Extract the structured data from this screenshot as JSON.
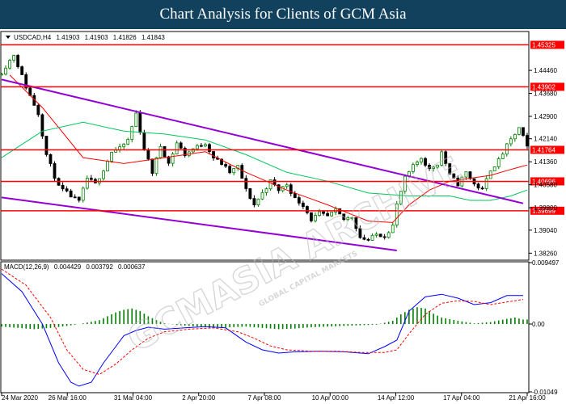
{
  "banner_title": "Chart Analysis for Clients of GCM Asia",
  "watermark": {
    "brand": "GCMASIA ARCHIVE",
    "tagline": "GLOBAL CAPITAL MARKETS"
  },
  "colors": {
    "banner": "#12415e",
    "bull_candle": "#008000",
    "bear_candle": "#000000",
    "support_resistance": "#ff0000",
    "trend_channel": "#9400d3",
    "ma_fast": "#ff0000",
    "ma_slow": "#00c85a",
    "macd_line": "#0000ff",
    "signal_line": "#ff0000",
    "histogram": "#008000"
  },
  "chart_data": [
    {
      "type": "candlestick",
      "header": {
        "symbol": "USDCAD,H4",
        "open": "1.41903",
        "high": "1.41903",
        "low": "1.41826",
        "close": "1.41843"
      },
      "ylim": [
        1.3805,
        1.4575
      ],
      "y_ticks": [
        "1.44460",
        "1.43680",
        "1.42900",
        "1.42140",
        "1.41360",
        "1.40580",
        "1.39800",
        "1.39040",
        "1.38260"
      ],
      "x_ticks": [
        "24 Mar 2020",
        "26 Mar 16:00",
        "31 Mar 04:00",
        "2 Apr 20:00",
        "7 Apr 08:00",
        "10 Apr 00:00",
        "14 Apr 12:00",
        "17 Apr 04:00",
        "21 Apr 16:00"
      ],
      "levels": [
        {
          "value": 1.45325,
          "label": "1.45325"
        },
        {
          "value": 1.43902,
          "label": "1.43902"
        },
        {
          "value": 1.41764,
          "label": "1.41764"
        },
        {
          "value": 1.40696,
          "label": "1.40696"
        },
        {
          "value": 1.39699,
          "label": "1.39699"
        }
      ],
      "trend_channel": [
        {
          "name": "upper",
          "from": [
            0,
            1.4415
          ],
          "to": [
            128,
            1.3995
          ]
        },
        {
          "name": "lower",
          "from": [
            0,
            1.4015
          ],
          "to": [
            97,
            1.3835
          ]
        }
      ],
      "close_path": [
        [
          0,
          1.444
        ],
        [
          3,
          1.45
        ],
        [
          6,
          1.439
        ],
        [
          9,
          1.43
        ],
        [
          11,
          1.416
        ],
        [
          14,
          1.405
        ],
        [
          17,
          1.402
        ],
        [
          19,
          1.4
        ],
        [
          21,
          1.408
        ],
        [
          23,
          1.406
        ],
        [
          25,
          1.411
        ],
        [
          27,
          1.417
        ],
        [
          29,
          1.418
        ],
        [
          31,
          1.421
        ],
        [
          33,
          1.43
        ],
        [
          35,
          1.418
        ],
        [
          37,
          1.41
        ],
        [
          39,
          1.419
        ],
        [
          41,
          1.413
        ],
        [
          43,
          1.42
        ],
        [
          45,
          1.416
        ],
        [
          47,
          1.418
        ],
        [
          50,
          1.42
        ],
        [
          52,
          1.415
        ],
        [
          54,
          1.413
        ],
        [
          56,
          1.41
        ],
        [
          58,
          1.412
        ],
        [
          60,
          1.404
        ],
        [
          62,
          1.399
        ],
        [
          64,
          1.403
        ],
        [
          66,
          1.407
        ],
        [
          68,
          1.404
        ],
        [
          70,
          1.406
        ],
        [
          72,
          1.401
        ],
        [
          74,
          1.399
        ],
        [
          76,
          1.394
        ],
        [
          78,
          1.396
        ],
        [
          80,
          1.395
        ],
        [
          82,
          1.397
        ],
        [
          84,
          1.394
        ],
        [
          86,
          1.395
        ],
        [
          88,
          1.388
        ],
        [
          90,
          1.387
        ],
        [
          92,
          1.389
        ],
        [
          94,
          1.3885
        ],
        [
          96,
          1.392
        ],
        [
          97,
          1.399
        ],
        [
          99,
          1.408
        ],
        [
          101,
          1.412
        ],
        [
          103,
          1.415
        ],
        [
          105,
          1.411
        ],
        [
          107,
          1.413
        ],
        [
          108,
          1.417
        ],
        [
          110,
          1.409
        ],
        [
          112,
          1.406
        ],
        [
          114,
          1.41
        ],
        [
          116,
          1.406
        ],
        [
          118,
          1.404
        ],
        [
          120,
          1.411
        ],
        [
          122,
          1.414
        ],
        [
          124,
          1.419
        ],
        [
          126,
          1.423
        ],
        [
          127,
          1.425
        ],
        [
          128,
          1.422
        ],
        [
          129,
          1.4184
        ]
      ],
      "moving_averages": [
        {
          "name": "fast",
          "values": [
            [
              2,
              1.443
            ],
            [
              10,
              1.432
            ],
            [
              20,
              1.415
            ],
            [
              30,
              1.413
            ],
            [
              40,
              1.415
            ],
            [
              50,
              1.417
            ],
            [
              60,
              1.41
            ],
            [
              70,
              1.404
            ],
            [
              80,
              1.399
            ],
            [
              90,
              1.3935
            ],
            [
              96,
              1.393
            ],
            [
              100,
              1.399
            ],
            [
              105,
              1.404
            ],
            [
              110,
              1.407
            ],
            [
              115,
              1.408
            ],
            [
              120,
              1.409
            ],
            [
              125,
              1.411
            ],
            [
              129,
              1.4125
            ]
          ]
        },
        {
          "name": "slow",
          "values": [
            [
              0,
              1.415
            ],
            [
              10,
              1.424
            ],
            [
              20,
              1.427
            ],
            [
              30,
              1.424
            ],
            [
              40,
              1.423
            ],
            [
              50,
              1.421
            ],
            [
              60,
              1.416
            ],
            [
              70,
              1.41
            ],
            [
              80,
              1.407
            ],
            [
              90,
              1.403
            ],
            [
              100,
              1.402
            ],
            [
              110,
              1.402
            ],
            [
              115,
              1.4005
            ],
            [
              120,
              1.4005
            ],
            [
              125,
              1.402
            ],
            [
              129,
              1.404
            ]
          ]
        }
      ]
    },
    {
      "type": "histogram",
      "header": {
        "name": "MACD(12,26,9)",
        "main": "0.004429",
        "signal": "0.003792",
        "histogram": "0.000637"
      },
      "ylim": [
        -0.01049,
        0.009497
      ],
      "y_ticks": [
        "0.009497",
        "0.00",
        "-0.01049"
      ],
      "histogram": [
        [
          0,
          -0.0004
        ],
        [
          4,
          -0.0006
        ],
        [
          8,
          -0.0008
        ],
        [
          12,
          -0.0006
        ],
        [
          16,
          -0.0003
        ],
        [
          20,
          0.0001
        ],
        [
          24,
          0.0006
        ],
        [
          26,
          0.0012
        ],
        [
          28,
          0.0018
        ],
        [
          30,
          0.0022
        ],
        [
          32,
          0.0024
        ],
        [
          34,
          0.002
        ],
        [
          36,
          0.0012
        ],
        [
          38,
          0.0006
        ],
        [
          40,
          0.0001
        ],
        [
          44,
          -0.0002
        ],
        [
          48,
          -0.0004
        ],
        [
          52,
          -0.0006
        ],
        [
          56,
          -0.0005
        ],
        [
          60,
          -0.0004
        ],
        [
          64,
          -0.0006
        ],
        [
          68,
          -0.0008
        ],
        [
          72,
          -0.0007
        ],
        [
          76,
          -0.0005
        ],
        [
          80,
          -0.0004
        ],
        [
          84,
          -0.0003
        ],
        [
          88,
          -0.0002
        ],
        [
          92,
          -0.0001
        ],
        [
          96,
          0.0005
        ],
        [
          98,
          0.0015
        ],
        [
          100,
          0.0022
        ],
        [
          102,
          0.0026
        ],
        [
          104,
          0.0024
        ],
        [
          106,
          0.0016
        ],
        [
          108,
          0.001
        ],
        [
          112,
          0.0005
        ],
        [
          116,
          0.0001
        ],
        [
          120,
          0.0003
        ],
        [
          124,
          0.0008
        ],
        [
          126,
          0.001
        ],
        [
          128,
          0.0007
        ]
      ],
      "series": [
        {
          "name": "main",
          "values": [
            [
              0,
              0.0078
            ],
            [
              5,
              0.005
            ],
            [
              10,
              0.0
            ],
            [
              14,
              -0.006
            ],
            [
              17,
              -0.009
            ],
            [
              19,
              -0.0096
            ],
            [
              22,
              -0.009
            ],
            [
              25,
              -0.006
            ],
            [
              28,
              -0.0035
            ],
            [
              30,
              -0.0018
            ],
            [
              33,
              -0.001
            ],
            [
              36,
              -0.0005
            ],
            [
              40,
              -0.0008
            ],
            [
              45,
              -0.0006
            ],
            [
              50,
              -0.0004
            ],
            [
              55,
              -0.0006
            ],
            [
              60,
              -0.0028
            ],
            [
              64,
              -0.004
            ],
            [
              68,
              -0.0045
            ],
            [
              72,
              -0.0043
            ],
            [
              78,
              -0.0042
            ],
            [
              84,
              -0.0043
            ],
            [
              90,
              -0.0046
            ],
            [
              94,
              -0.0035
            ],
            [
              97,
              -0.0025
            ],
            [
              100,
              0.002
            ],
            [
              104,
              0.0042
            ],
            [
              108,
              0.0046
            ],
            [
              112,
              0.004
            ],
            [
              116,
              0.003
            ],
            [
              120,
              0.0033
            ],
            [
              124,
              0.0044
            ],
            [
              128,
              0.0044
            ]
          ]
        },
        {
          "name": "signal",
          "values": [
            [
              0,
              0.0085
            ],
            [
              6,
              0.006
            ],
            [
              12,
              0.001
            ],
            [
              16,
              -0.004
            ],
            [
              20,
              -0.007
            ],
            [
              24,
              -0.0078
            ],
            [
              28,
              -0.0062
            ],
            [
              32,
              -0.004
            ],
            [
              36,
              -0.0022
            ],
            [
              40,
              -0.0012
            ],
            [
              46,
              -0.0008
            ],
            [
              52,
              -0.0006
            ],
            [
              58,
              -0.0012
            ],
            [
              62,
              -0.0022
            ],
            [
              66,
              -0.0034
            ],
            [
              70,
              -0.004
            ],
            [
              76,
              -0.0042
            ],
            [
              82,
              -0.0042
            ],
            [
              88,
              -0.0044
            ],
            [
              94,
              -0.0044
            ],
            [
              97,
              -0.004
            ],
            [
              100,
              -0.0015
            ],
            [
              104,
              0.0015
            ],
            [
              108,
              0.0032
            ],
            [
              112,
              0.0036
            ],
            [
              116,
              0.0035
            ],
            [
              120,
              0.003
            ],
            [
              124,
              0.0034
            ],
            [
              128,
              0.0038
            ]
          ]
        }
      ]
    }
  ]
}
